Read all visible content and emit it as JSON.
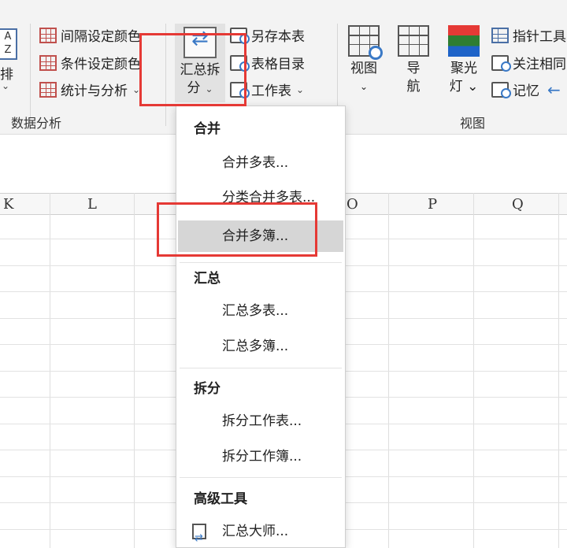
{
  "ribbon": {
    "left_partial": {
      "icon_top": "A",
      "icon_bottom": "Z",
      "label": "级排",
      "chevron": "⌄"
    },
    "data_analysis": {
      "items": [
        "间隔设定颜色",
        "条件设定颜色",
        "统计与分析"
      ],
      "group_label": "数据分析"
    },
    "summary_split": {
      "label_line1": "汇总拆",
      "label_line2": "分"
    },
    "sheet_tools": [
      "另存本表",
      "表格目录",
      "工作表"
    ],
    "view": {
      "buttons": [
        {
          "line1": "视图",
          "line2": "⌄"
        },
        {
          "line1": "导",
          "line2": "航"
        },
        {
          "line1": "聚光",
          "line2": "灯 ⌄"
        }
      ],
      "group_label": "视图"
    },
    "right_items": [
      "指针工具",
      "关注相同",
      "记忆"
    ],
    "chevron": "⌄"
  },
  "columns": [
    "K",
    "L",
    "O",
    "P",
    "Q"
  ],
  "menu": {
    "sections": [
      {
        "title": "合并",
        "items": [
          "合并多表...",
          "分类合并多表...",
          "合并多簿..."
        ]
      },
      {
        "title": "汇总",
        "items": [
          "汇总多表...",
          "汇总多簿..."
        ]
      },
      {
        "title": "拆分",
        "items": [
          "拆分工作表...",
          "拆分工作簿..."
        ]
      },
      {
        "title": "高级工具",
        "items": [
          "汇总大师..."
        ]
      }
    ],
    "highlighted": "合并多簿..."
  },
  "colors": {
    "highlight_box": "#e53935",
    "hover_bg": "#d6d6d6",
    "ribbon_bg": "#f3f3f3"
  }
}
